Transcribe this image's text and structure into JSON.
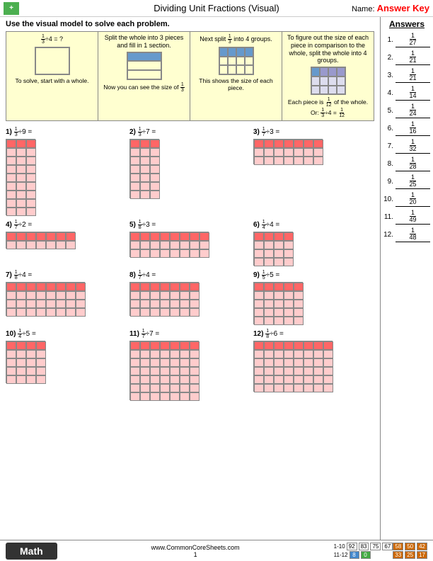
{
  "header": {
    "title": "Dividing Unit Fractions (Visual)",
    "name_label": "Name:",
    "answer_key": "Answer Key",
    "logo": "+"
  },
  "instructions": "Use the visual model to solve each problem.",
  "example": {
    "step1": {
      "label": "1/3 ÷ 4 = ?",
      "caption": "To solve, start with a whole."
    },
    "step2": {
      "label": "Split the whole into 3 pieces and fill in 1 section.",
      "caption": "Now you can see the size of 1/3"
    },
    "step3": {
      "label": "Next split 1/3 into 4 groups.",
      "caption": "This shows the size of each piece."
    },
    "step4": {
      "label": "To figure out the size of each piece in comparison to the whole, split the whole into 4 groups.",
      "caption": "Each piece is 1/12 of the whole. Or: 1/3 ÷ 4 = 1/12"
    }
  },
  "problems": [
    {
      "id": "1",
      "fraction": "1/3",
      "divisor": "9",
      "answer": "1/27",
      "rows": 9,
      "cols": 3,
      "filled_row": 1
    },
    {
      "id": "2",
      "fraction": "1/3",
      "divisor": "7",
      "answer": "1/21",
      "rows": 7,
      "cols": 3,
      "filled_row": 1
    },
    {
      "id": "3",
      "fraction": "1/7",
      "divisor": "3",
      "answer": "1/21",
      "rows": 3,
      "cols": 7,
      "filled_row": 1
    },
    {
      "id": "4",
      "fraction": "1/7",
      "divisor": "2",
      "answer": "1/14",
      "rows": 2,
      "cols": 7,
      "filled_row": 1
    },
    {
      "id": "5",
      "fraction": "1/8",
      "divisor": "3",
      "answer": "1/24",
      "rows": 3,
      "cols": 8,
      "filled_row": 1
    },
    {
      "id": "6",
      "fraction": "1/4",
      "divisor": "4",
      "answer": "1/16",
      "rows": 4,
      "cols": 4,
      "filled_row": 1
    },
    {
      "id": "7",
      "fraction": "1/8",
      "divisor": "4",
      "answer": "1/32",
      "rows": 4,
      "cols": 8,
      "filled_row": 1
    },
    {
      "id": "8",
      "fraction": "1/7",
      "divisor": "4",
      "answer": "1/28",
      "rows": 4,
      "cols": 7,
      "filled_row": 1
    },
    {
      "id": "9",
      "fraction": "1/5",
      "divisor": "5",
      "answer": "1/25",
      "rows": 5,
      "cols": 5,
      "filled_row": 1
    },
    {
      "id": "10",
      "fraction": "1/4",
      "divisor": "5",
      "answer": "1/20",
      "rows": 5,
      "cols": 4,
      "filled_row": 1
    },
    {
      "id": "11",
      "fraction": "1/7",
      "divisor": "7",
      "answer": "1/49",
      "rows": 7,
      "cols": 7,
      "filled_row": 1
    },
    {
      "id": "12",
      "fraction": "1/8",
      "divisor": "6",
      "answer": "1/48",
      "rows": 6,
      "cols": 8,
      "filled_row": 1
    }
  ],
  "answers": [
    {
      "num": "1.",
      "top": "1",
      "bot": "27"
    },
    {
      "num": "2.",
      "top": "1",
      "bot": "21"
    },
    {
      "num": "3.",
      "top": "1",
      "bot": "21"
    },
    {
      "num": "4.",
      "top": "1",
      "bot": "14"
    },
    {
      "num": "5.",
      "top": "1",
      "bot": "24"
    },
    {
      "num": "6.",
      "top": "1",
      "bot": "16"
    },
    {
      "num": "7.",
      "top": "1",
      "bot": "32"
    },
    {
      "num": "8.",
      "top": "1",
      "bot": "28"
    },
    {
      "num": "9.",
      "top": "1",
      "bot": "25"
    },
    {
      "num": "10.",
      "top": "1",
      "bot": "20"
    },
    {
      "num": "11.",
      "top": "1",
      "bot": "49"
    },
    {
      "num": "12.",
      "top": "1",
      "bot": "48"
    }
  ],
  "footer": {
    "math_label": "Math",
    "url": "www.CommonCoreSheets.com",
    "page": "1",
    "score_rows": [
      {
        "label": "1-10",
        "scores": [
          "92",
          "83",
          "75",
          "67"
        ]
      },
      {
        "label": "11-12",
        "scores": [
          "8",
          "0"
        ]
      }
    ],
    "percent_labels": [
      "58",
      "50",
      "42",
      "33",
      "25",
      "17"
    ]
  }
}
